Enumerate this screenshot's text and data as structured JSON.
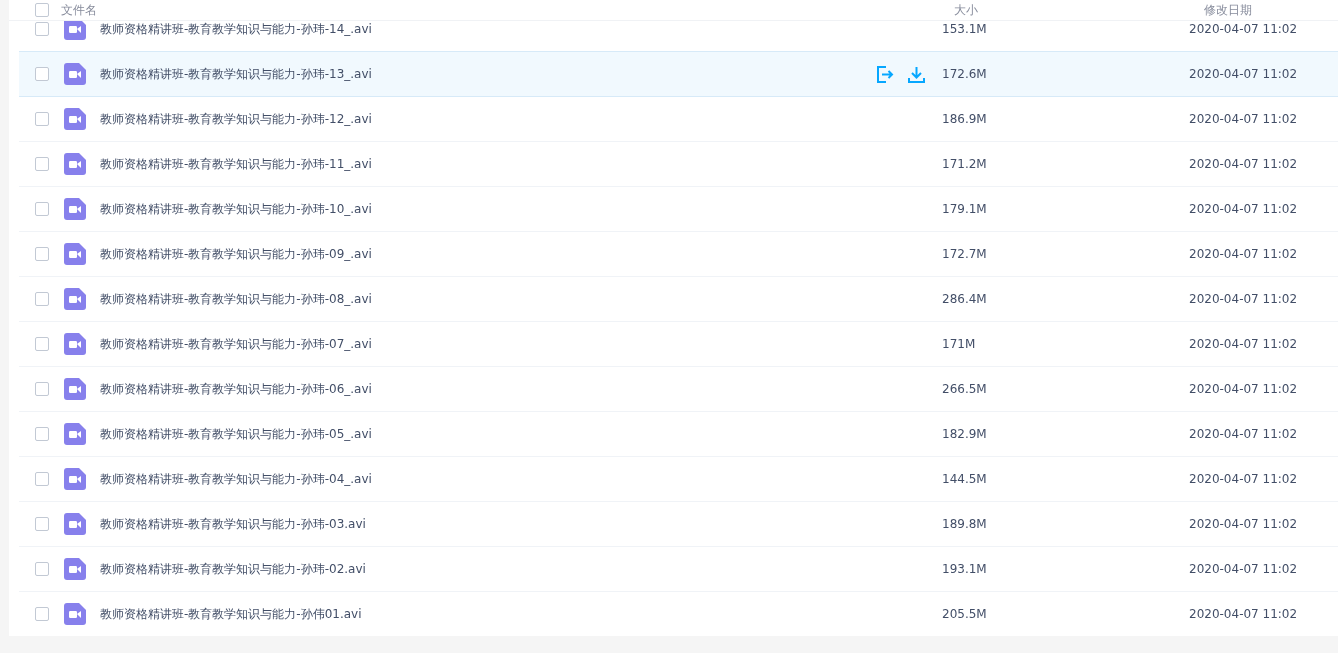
{
  "header": {
    "select_all_checked": false,
    "columns": [
      "文件名",
      "大小",
      "修改日期"
    ]
  },
  "files": [
    {
      "name": "教师资格精讲班-教育教学知识与能力-孙玮-14_.avi",
      "size": "153.1M",
      "modified": "2020-04-07 11:02",
      "checked": false,
      "hovered": false
    },
    {
      "name": "教师资格精讲班-教育教学知识与能力-孙玮-13_.avi",
      "size": "172.6M",
      "modified": "2020-04-07 11:02",
      "checked": false,
      "hovered": true
    },
    {
      "name": "教师资格精讲班-教育教学知识与能力-孙玮-12_.avi",
      "size": "186.9M",
      "modified": "2020-04-07 11:02",
      "checked": false,
      "hovered": false
    },
    {
      "name": "教师资格精讲班-教育教学知识与能力-孙玮-11_.avi",
      "size": "171.2M",
      "modified": "2020-04-07 11:02",
      "checked": false,
      "hovered": false
    },
    {
      "name": "教师资格精讲班-教育教学知识与能力-孙玮-10_.avi",
      "size": "179.1M",
      "modified": "2020-04-07 11:02",
      "checked": false,
      "hovered": false
    },
    {
      "name": "教师资格精讲班-教育教学知识与能力-孙玮-09_.avi",
      "size": "172.7M",
      "modified": "2020-04-07 11:02",
      "checked": false,
      "hovered": false
    },
    {
      "name": "教师资格精讲班-教育教学知识与能力-孙玮-08_.avi",
      "size": "286.4M",
      "modified": "2020-04-07 11:02",
      "checked": false,
      "hovered": false
    },
    {
      "name": "教师资格精讲班-教育教学知识与能力-孙玮-07_.avi",
      "size": "171M",
      "modified": "2020-04-07 11:02",
      "checked": false,
      "hovered": false
    },
    {
      "name": "教师资格精讲班-教育教学知识与能力-孙玮-06_.avi",
      "size": "266.5M",
      "modified": "2020-04-07 11:02",
      "checked": false,
      "hovered": false
    },
    {
      "name": "教师资格精讲班-教育教学知识与能力-孙玮-05_.avi",
      "size": "182.9M",
      "modified": "2020-04-07 11:02",
      "checked": false,
      "hovered": false
    },
    {
      "name": "教师资格精讲班-教育教学知识与能力-孙玮-04_.avi",
      "size": "144.5M",
      "modified": "2020-04-07 11:02",
      "checked": false,
      "hovered": false
    },
    {
      "name": "教师资格精讲班-教育教学知识与能力-孙玮-03.avi",
      "size": "189.8M",
      "modified": "2020-04-07 11:02",
      "checked": false,
      "hovered": false
    },
    {
      "name": "教师资格精讲班-教育教学知识与能力-孙玮-02.avi",
      "size": "193.1M",
      "modified": "2020-04-07 11:02",
      "checked": false,
      "hovered": false
    },
    {
      "name": "教师资格精讲班-教育教学知识与能力-孙伟01.avi",
      "size": "205.5M",
      "modified": "2020-04-07 11:02",
      "checked": false,
      "hovered": false
    }
  ]
}
